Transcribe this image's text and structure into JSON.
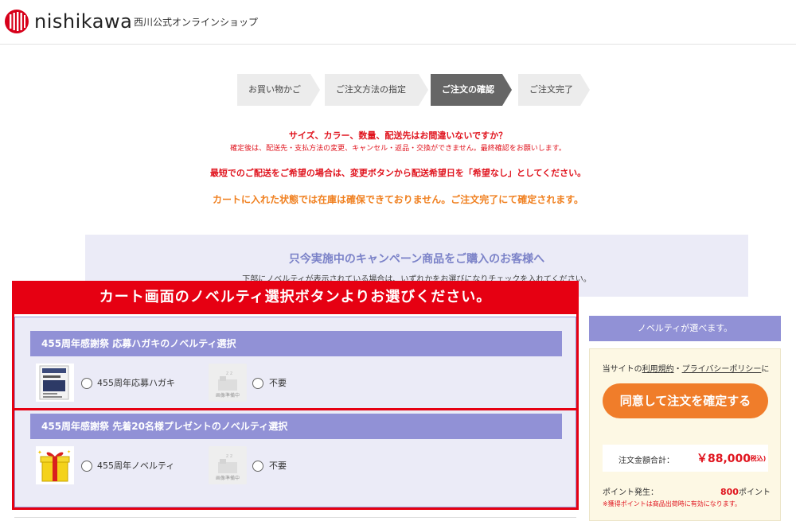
{
  "header": {
    "logo_text": "nishikawa",
    "shop_name": "西川公式オンラインショップ"
  },
  "steps": [
    {
      "label": "お買い物かご",
      "active": false
    },
    {
      "label": "ご注文方法の指定",
      "active": false
    },
    {
      "label": "ご注文の確認",
      "active": true
    },
    {
      "label": "ご注文完了",
      "active": false
    }
  ],
  "notices": {
    "line1": "サイズ、カラー、数量、配送先はお間違いないですか？",
    "line2": "確定後は、配送先・支払方法の変更、キャンセル・返品・交換ができません。最終確認をお願いします。",
    "line3": "最短でのご配送をご希望の場合は、変更ボタンから配送希望日を「希望なし」としてください。",
    "line4": "カートに入れた状態では在庫は確保できておりません。ご注文完了にて確定されます。"
  },
  "campaign": {
    "title": "只今実施中のキャンペーン商品をご購入のお客様へ",
    "desc": "下部にノベルティが表示されている場合は、いずれかをお選びになりチェックを入れてください。"
  },
  "banner": "カート画面のノベルティ選択ボタンよりお選びください。",
  "novelty_sections": [
    {
      "title": "455周年感謝祭 応募ハガキのノベルティ選択",
      "option1": "455周年応募ハガキ",
      "option2": "不要",
      "placeholder_text": "画像準備中"
    },
    {
      "title": "455周年感謝祭 先着20名様プレゼントのノベルティ選択",
      "option1": "455周年ノベルティ",
      "option2": "不要",
      "placeholder_text": "画像準備中"
    }
  ],
  "sidebar": {
    "head": "ノベルティが選べます。",
    "terms_prefix": "当サイトの",
    "terms_link": "利用規約",
    "terms_sep": "・",
    "privacy_link": "プライバシーポリシー",
    "terms_suffix": "に",
    "confirm_button": "同意して注文を確定する",
    "total_label": "注文金額合計：",
    "total_value": "￥88,000",
    "total_tax": "(税込)",
    "points_label": "ポイント発生：",
    "points_value": "800",
    "points_unit": "ポイント",
    "points_note": "※獲得ポイントは商品出荷時に有効になります。"
  },
  "colors": {
    "red": "#e60012",
    "orange": "#f07d2a",
    "purple": "#9191d6"
  }
}
